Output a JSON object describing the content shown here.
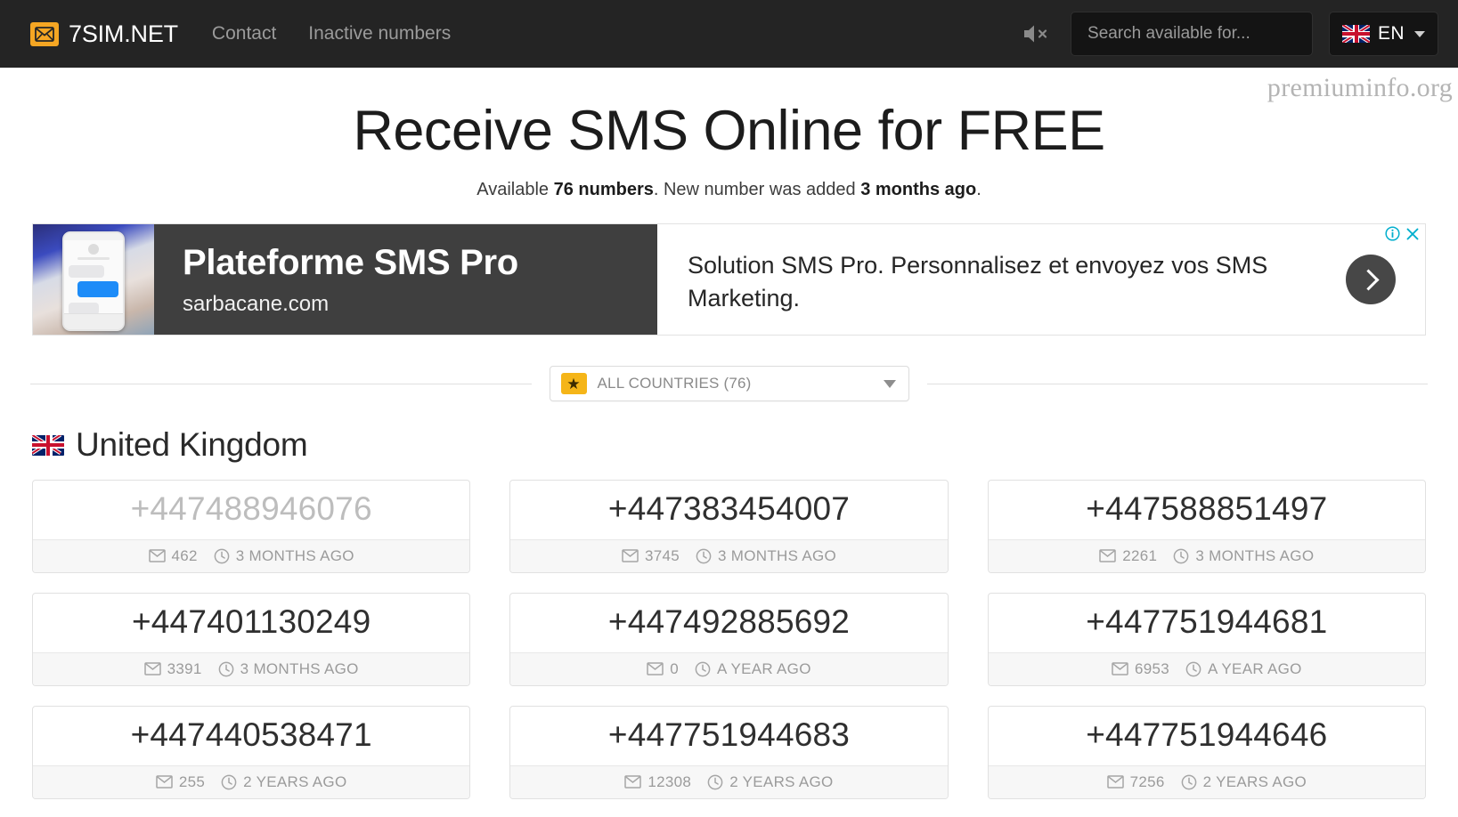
{
  "header": {
    "logo_icon": "envelope-icon",
    "brand": "7SIM.NET",
    "nav": [
      {
        "label": "Contact"
      },
      {
        "label": "Inactive numbers"
      }
    ],
    "sound_icon": "speaker-muted-icon",
    "search": {
      "placeholder": "Search available for...",
      "value": ""
    },
    "language": {
      "flag_icon": "uk-flag-icon",
      "label": "EN",
      "caret_icon": "chevron-down-icon"
    }
  },
  "hero": {
    "watermark": "premiuminfo.org",
    "title": "Receive SMS Online for FREE",
    "subtitle_prefix": "Available ",
    "subtitle_count": "76 numbers",
    "subtitle_middle": ". New number was added ",
    "subtitle_time": "3 months ago",
    "subtitle_suffix": "."
  },
  "ad": {
    "headline": "Plateforme SMS Pro",
    "domain": "sarbacane.com",
    "body": "Solution SMS Pro. Personnalisez et envoyez vos SMS Marketing.",
    "next_icon": "chevron-right-icon",
    "info_icon": "adchoices-info-icon",
    "close_icon": "close-icon"
  },
  "filter": {
    "star_icon": "star-icon",
    "selected": "ALL COUNTRIES (76)",
    "caret_icon": "chevron-down-icon"
  },
  "country": {
    "flag_icon": "uk-flag-icon",
    "name": "United Kingdom"
  },
  "meta_icons": {
    "messages": "envelope-icon",
    "time": "clock-icon"
  },
  "numbers": [
    {
      "number": "+447488946076",
      "messages": "462",
      "updated": "3 MONTHS AGO",
      "visited": true
    },
    {
      "number": "+447383454007",
      "messages": "3745",
      "updated": "3 MONTHS AGO",
      "visited": false
    },
    {
      "number": "+447588851497",
      "messages": "2261",
      "updated": "3 MONTHS AGO",
      "visited": false
    },
    {
      "number": "+447401130249",
      "messages": "3391",
      "updated": "3 MONTHS AGO",
      "visited": false
    },
    {
      "number": "+447492885692",
      "messages": "0",
      "updated": "A YEAR AGO",
      "visited": false
    },
    {
      "number": "+447751944681",
      "messages": "6953",
      "updated": "A YEAR AGO",
      "visited": false
    },
    {
      "number": "+447440538471",
      "messages": "255",
      "updated": "2 YEARS AGO",
      "visited": false
    },
    {
      "number": "+447751944683",
      "messages": "12308",
      "updated": "2 YEARS AGO",
      "visited": false
    },
    {
      "number": "+447751944646",
      "messages": "7256",
      "updated": "2 YEARS AGO",
      "visited": false
    }
  ],
  "colors": {
    "navbar_bg": "#242424",
    "brand_accent": "#f5a623",
    "star_badge": "#f5b518",
    "ad_dark": "#3f3f3f",
    "ad_icon_blue": "#00aecd",
    "card_meta_bg": "#f7f7f7",
    "visited_number": "#bdbdbd"
  }
}
